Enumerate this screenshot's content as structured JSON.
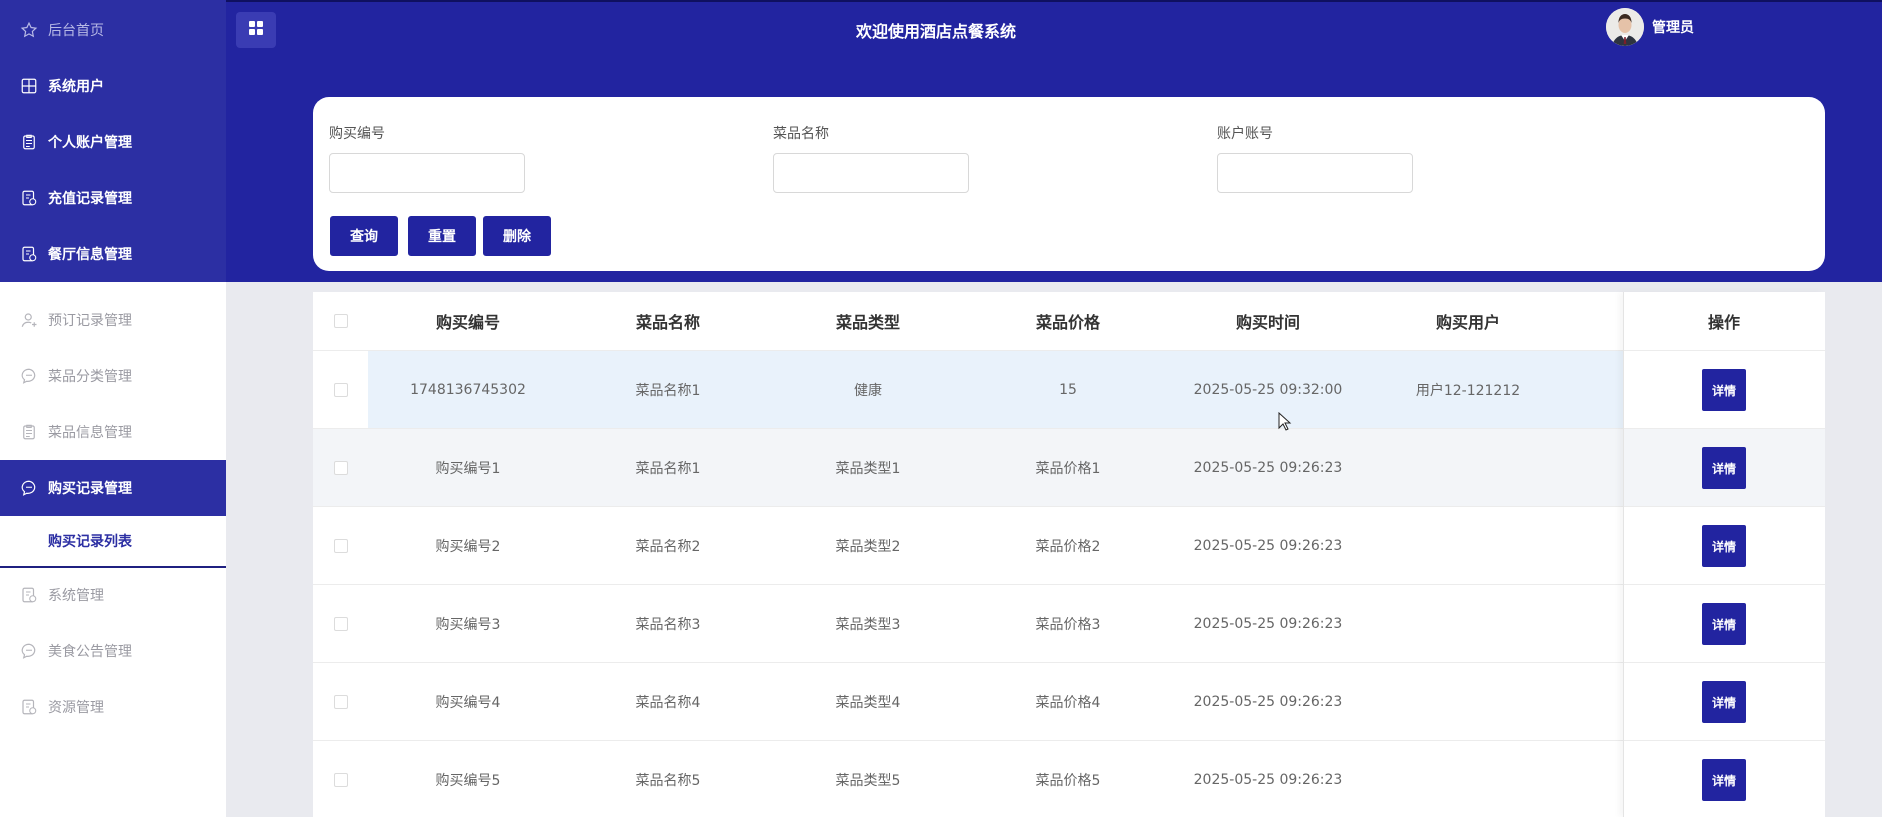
{
  "app": {
    "title": "欢迎使用酒店点餐系统",
    "user_name": "管理员"
  },
  "sidebar": {
    "items": [
      {
        "label": "后台首页",
        "icon": "star-icon"
      },
      {
        "label": "系统用户",
        "icon": "grid-icon"
      },
      {
        "label": "个人账户管理",
        "icon": "clipboard-icon"
      },
      {
        "label": "充值记录管理",
        "icon": "document-icon"
      },
      {
        "label": "餐厅信息管理",
        "icon": "document-icon"
      },
      {
        "label": "预订记录管理",
        "icon": "user-icon"
      },
      {
        "label": "菜品分类管理",
        "icon": "chat-icon"
      },
      {
        "label": "菜品信息管理",
        "icon": "clipboard-icon"
      },
      {
        "label": "购买记录管理",
        "icon": "chat-icon"
      },
      {
        "label": "系统管理",
        "icon": "document-icon"
      },
      {
        "label": "美食公告管理",
        "icon": "chat-icon"
      },
      {
        "label": "资源管理",
        "icon": "document-icon"
      }
    ],
    "sub_item": "购买记录列表"
  },
  "search": {
    "fields": [
      {
        "label": "购买编号",
        "value": ""
      },
      {
        "label": "菜品名称",
        "value": ""
      },
      {
        "label": "账户账号",
        "value": ""
      }
    ],
    "buttons": {
      "query": "查询",
      "reset": "重置",
      "delete": "删除"
    }
  },
  "table": {
    "headers": [
      "购买编号",
      "菜品名称",
      "菜品类型",
      "菜品价格",
      "购买时间",
      "购买用户"
    ],
    "op_header": "操作",
    "detail_label": "详情",
    "rows": [
      [
        "1748136745302",
        "菜品名称1",
        "健康",
        "15",
        "2025-05-25 09:32:00",
        "用户12-121212"
      ],
      [
        "购买编号1",
        "菜品名称1",
        "菜品类型1",
        "菜品价格1",
        "2025-05-25 09:26:23",
        ""
      ],
      [
        "购买编号2",
        "菜品名称2",
        "菜品类型2",
        "菜品价格2",
        "2025-05-25 09:26:23",
        ""
      ],
      [
        "购买编号3",
        "菜品名称3",
        "菜品类型3",
        "菜品价格3",
        "2025-05-25 09:26:23",
        ""
      ],
      [
        "购买编号4",
        "菜品名称4",
        "菜品类型4",
        "菜品价格4",
        "2025-05-25 09:26:23",
        ""
      ],
      [
        "购买编号5",
        "菜品名称5",
        "菜品类型5",
        "菜品价格5",
        "2025-05-25 09:26:23",
        ""
      ]
    ]
  },
  "colors": {
    "primary": "#2224a0",
    "sidebar_dark": "#2c2fa3",
    "active_sub": "#2c2fa3"
  }
}
